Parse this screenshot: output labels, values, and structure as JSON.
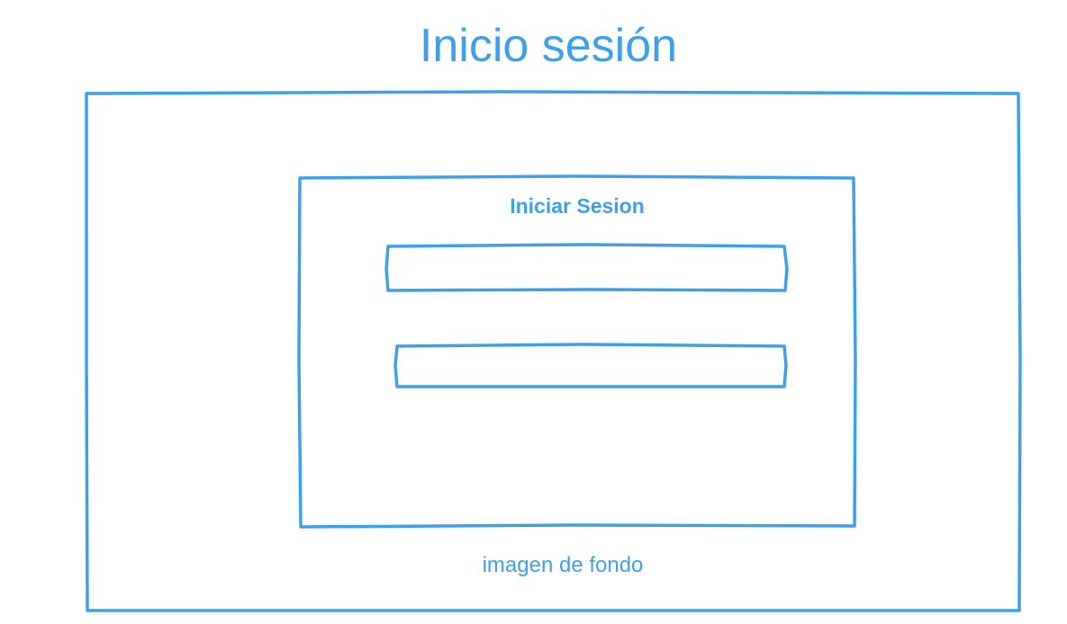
{
  "page": {
    "title": "Inicio sesión",
    "background_caption": "imagen de fondo"
  },
  "login_panel": {
    "heading": "Iniciar Sesion",
    "fields": [
      {
        "value": "",
        "placeholder": ""
      },
      {
        "value": "",
        "placeholder": ""
      }
    ]
  },
  "colors": {
    "stroke": "#3ea0e8",
    "background": "#ffffff"
  }
}
